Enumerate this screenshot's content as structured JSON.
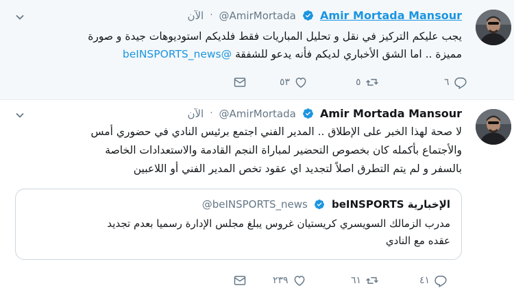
{
  "tweet1": {
    "author_name": "Amir Mortada Mansour",
    "handle": "@AmirMortada",
    "time": "الآن",
    "line1": "يجب عليكم التركيز في نقل و تحليل المباريات فقط فلديكم استوديوهات جيدة و صورة",
    "line2_prefix": "مميزة .. اما الشق الأخباري لديكم فأنه يدعو للشفقة ",
    "mention": "@beINSPORTS_news",
    "reply_count": "٦",
    "retweet_count": "٥",
    "like_count": "٥٣"
  },
  "tweet2": {
    "author_name": "Amir Mortada Mansour",
    "handle": "@AmirMortada",
    "time": "الآن",
    "line1": "لا صحة لهذا الخبر على الإطلاق .. المدير الفني اجتمع برئيس النادي في حضوري أمس",
    "line2": "والأجتماع بأكمله كان بخصوص التحضير لمباراة النجم القادمة والاستعدادات الخاصة",
    "line3": "بالسفر و لم يتم التطرق اصلاً لتجديد اي عقود تخص المدير الفني أو اللاعبين",
    "quote": {
      "name": "beINSPORTS الإخبارية",
      "handle": "@beINSPORTS_news",
      "line1": "مدرب الزمالك السويسري كريستيان غروس يبلغ مجلس الإدارة رسميا بعدم تجديد",
      "line2": "عقده مع النادي"
    },
    "reply_count": "٤١",
    "retweet_count": "٦١",
    "like_count": "٢٣٩"
  },
  "icons": {
    "accent": "#1b95e0",
    "muted": "#657786",
    "verified": "verified-badge-icon",
    "reply": "reply-icon",
    "retweet": "retweet-icon",
    "like": "heart-icon",
    "dm": "envelope-icon"
  }
}
